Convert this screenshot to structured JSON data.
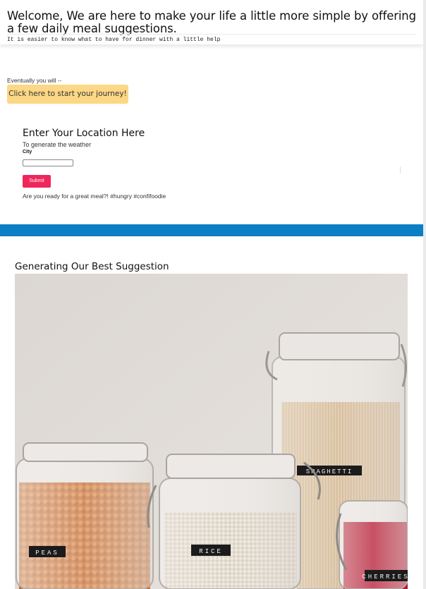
{
  "header": {
    "title": "Welcome, We are here to make your life a little more simple by offering a few daily meal suggestions.",
    "subtitle": "It is easier to know what to have for dinner with a little help"
  },
  "journey": {
    "prompt": "Eventually you will --",
    "button_label": "Click here to start your journey!"
  },
  "location": {
    "title": "Enter Your Location Here",
    "subtitle": "To generate the weather",
    "city_label": "City",
    "city_value": "",
    "submit_label": "Submit",
    "tagline": "Are you ready for a great meal?! #hungry #confifoodie"
  },
  "suggestion": {
    "title": "Generating Our Best Suggestion",
    "jar_labels": [
      "PEAS",
      "RICE",
      "SPAGHETTI",
      "CHERRIES"
    ]
  },
  "colors": {
    "journey_button": "#fcd785",
    "submit_button": "#f0265a",
    "band": "#0a7fc4"
  }
}
